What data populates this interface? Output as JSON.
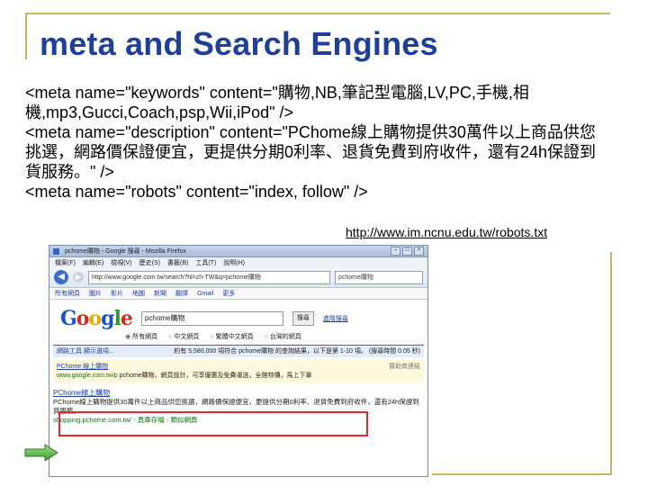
{
  "slide": {
    "title": "meta and Search Engines",
    "lines": [
      "<meta name=\"keywords\" content=\"購物,NB,筆記型電腦,LV,PC,手機,相機,mp3,Gucci,Coach,psp,Wii,iPod\" />",
      "<meta name=\"description\" content=\"PChome線上購物提供30萬件以上商品供您挑選，網路價保證便宜，更提供分期0利率、退貨免費到府收件，還有24h保證到貨服務。\" />",
      "<meta name=\"robots\" content=\"index, follow\" />"
    ],
    "link": "http://www.im.ncnu.edu.tw/robots.txt"
  },
  "browser": {
    "window_title": "pchome購物 - Google 搜尋 - Mozilla Firefox",
    "menu": [
      "檔案(F)",
      "編輯(E)",
      "檢視(V)",
      "歷史(S)",
      "書籤(B)",
      "工具(T)",
      "說明(H)"
    ],
    "address": "http://www.google.com.tw/search?hl=zh-TW&q=pchome購物",
    "search_box": "pchome購物",
    "bookmarks": [
      "所有網頁",
      "圖片",
      "影片",
      "地圖",
      "新聞",
      "翻譯",
      "Gmail",
      "更多"
    ],
    "google": {
      "logo_letters": [
        "G",
        "o",
        "o",
        "g",
        "l",
        "e"
      ],
      "query": "pchome購物",
      "search_button": "搜尋",
      "advanced": "進階搜尋",
      "radios": [
        "所有網頁",
        "中文網頁",
        "繁體中文網頁",
        "台灣的網頁"
      ],
      "stats_left": "網路工具  顯示選項...",
      "stats_right": "約有 5,580,000 項符合 pchome購物 的查詢結果，以下是第 1-10 項。 (搜尋時間 0.05 秒)",
      "ad": {
        "title": "PChome 線上購物",
        "url": "www.google.com.tw/p",
        "text": "pchome購物，網頁設計，可享優惠及免費運送，全館特價，馬上下單",
        "side": "贊助商連結"
      },
      "result": {
        "title": "PChome線上購物",
        "snippet": "PChome線上購物提供30萬件以上商品供您挑選，網路價保證便宜，更提供分期0利率、退貨免費到府收件，還有24h保證到貨服務。",
        "url": "shopping.pchome.com.tw/ - 頁庫存檔 - 類似網頁"
      }
    }
  }
}
